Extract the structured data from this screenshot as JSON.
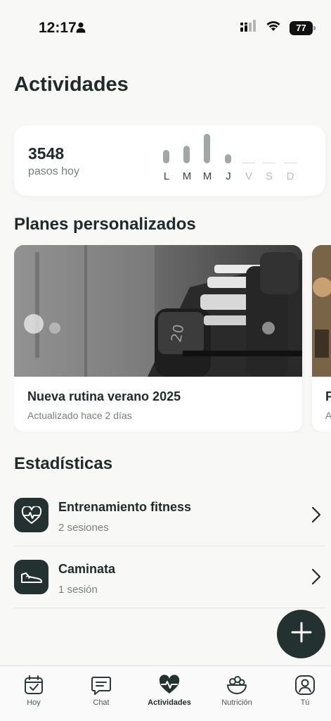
{
  "status_bar": {
    "time": "12:17",
    "battery": "77"
  },
  "page_title": "Actividades",
  "steps": {
    "count": "3548",
    "label": "pasos hoy",
    "week": [
      {
        "label": "L",
        "level": 0.45,
        "future": false
      },
      {
        "label": "M",
        "level": 0.6,
        "future": false
      },
      {
        "label": "M",
        "level": 1.0,
        "future": false
      },
      {
        "label": "J",
        "level": 0.3,
        "future": false
      },
      {
        "label": "V",
        "level": 0,
        "future": true
      },
      {
        "label": "S",
        "level": 0,
        "future": true
      },
      {
        "label": "D",
        "level": 0,
        "future": true
      }
    ]
  },
  "plans": {
    "title": "Planes personalizados",
    "items": [
      {
        "name": "Nueva rutina verano 2025",
        "updated": "Actualizado hace 2 días",
        "image": "dumbbell-rack-photo"
      },
      {
        "name": "P",
        "updated": "A",
        "image": "gym-photo"
      }
    ]
  },
  "stats": {
    "title": "Estadísticas",
    "items": [
      {
        "title": "Entrenamiento fitness",
        "subtitle": "2 sesiones",
        "icon": "heart-pulse-icon"
      },
      {
        "title": "Caminata",
        "subtitle": "1 sesión",
        "icon": "sneaker-icon"
      }
    ]
  },
  "fab_icon": "plus-icon",
  "tabs": [
    {
      "label": "Hoy",
      "icon": "calendar-check-icon",
      "active": false
    },
    {
      "label": "Chat",
      "icon": "chat-icon",
      "active": false
    },
    {
      "label": "Actividades",
      "icon": "heart-pulse-icon",
      "active": true
    },
    {
      "label": "Nutrición",
      "icon": "salad-bowl-icon",
      "active": false
    },
    {
      "label": "Tú",
      "icon": "profile-icon",
      "active": false
    }
  ],
  "colors": {
    "accent": "#243131",
    "background": "#f8f8f7",
    "card": "#ffffff",
    "muted_text": "#7a7f7f",
    "bar": "#a3a6a6"
  }
}
